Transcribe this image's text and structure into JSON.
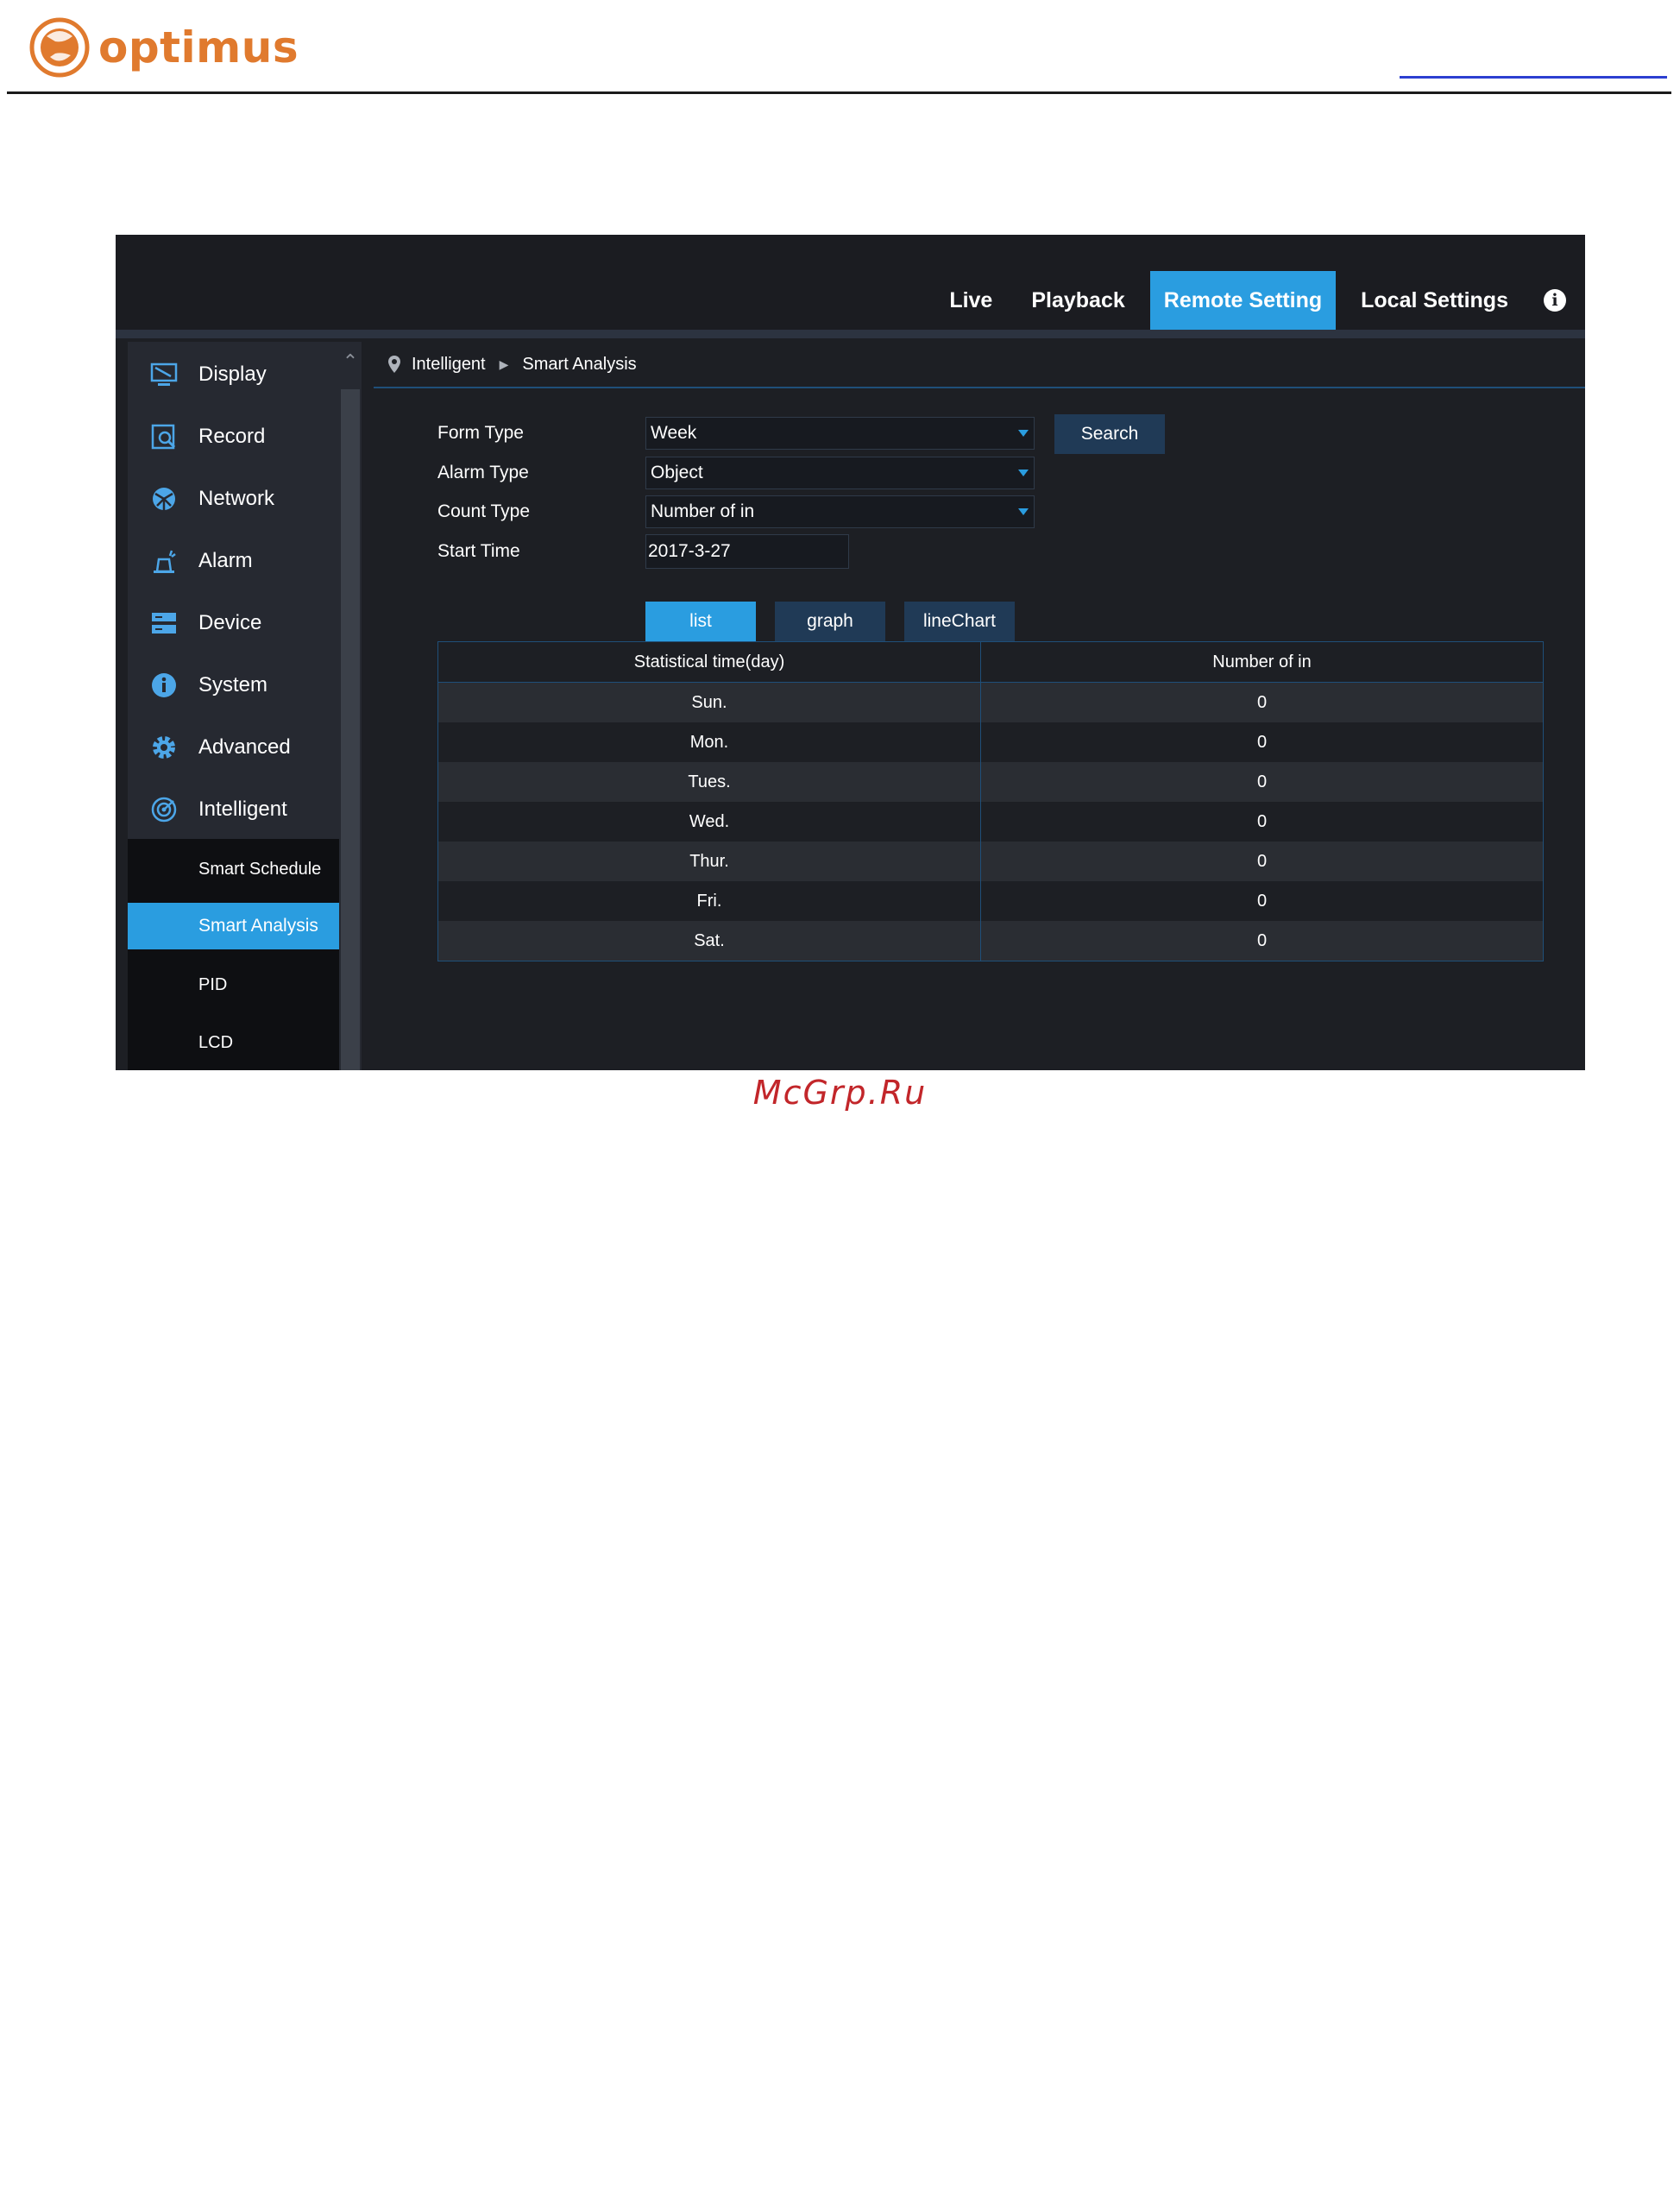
{
  "document": {
    "brand": "optimus",
    "watermark": "McGrp.Ru"
  },
  "topnav": {
    "items": [
      {
        "label": "Live",
        "active": false
      },
      {
        "label": "Playback",
        "active": false
      },
      {
        "label": "Remote Setting",
        "active": true
      },
      {
        "label": "Local Settings",
        "active": false
      }
    ]
  },
  "sidebar": {
    "items": [
      {
        "label": "Display",
        "icon": "monitor-icon"
      },
      {
        "label": "Record",
        "icon": "record-icon"
      },
      {
        "label": "Network",
        "icon": "network-icon"
      },
      {
        "label": "Alarm",
        "icon": "alarm-icon"
      },
      {
        "label": "Device",
        "icon": "device-icon"
      },
      {
        "label": "System",
        "icon": "info-icon"
      },
      {
        "label": "Advanced",
        "icon": "gear-icon"
      },
      {
        "label": "Intelligent",
        "icon": "intelligent-icon"
      }
    ],
    "subitems": [
      {
        "label": "Smart Schedule",
        "active": false
      },
      {
        "label": "Smart Analysis",
        "active": true
      },
      {
        "label": "PID",
        "active": false
      },
      {
        "label": "LCD",
        "active": false
      }
    ]
  },
  "breadcrumb": {
    "parent": "Intelligent",
    "current": "Smart Analysis"
  },
  "form": {
    "form_type_label": "Form Type",
    "form_type_value": "Week",
    "alarm_type_label": "Alarm Type",
    "alarm_type_value": "Object",
    "count_type_label": "Count Type",
    "count_type_value": "Number of in",
    "start_time_label": "Start Time",
    "start_time_value": "2017-3-27",
    "search_label": "Search"
  },
  "view_tabs": [
    {
      "label": "list",
      "active": true
    },
    {
      "label": "graph",
      "active": false
    },
    {
      "label": "lineChart",
      "active": false
    }
  ],
  "table": {
    "columns": [
      "Statistical time(day)",
      "Number of in"
    ],
    "rows": [
      [
        "Sun.",
        "0"
      ],
      [
        "Mon.",
        "0"
      ],
      [
        "Tues.",
        "0"
      ],
      [
        "Wed.",
        "0"
      ],
      [
        "Thur.",
        "0"
      ],
      [
        "Fri.",
        "0"
      ],
      [
        "Sat.",
        "0"
      ]
    ]
  },
  "colors": {
    "accent": "#2a9de0",
    "panel_bg": "#1d1f24",
    "sidebar_bg": "#262931",
    "brand_orange": "#e07a2e",
    "watermark_red": "#c2262a"
  }
}
